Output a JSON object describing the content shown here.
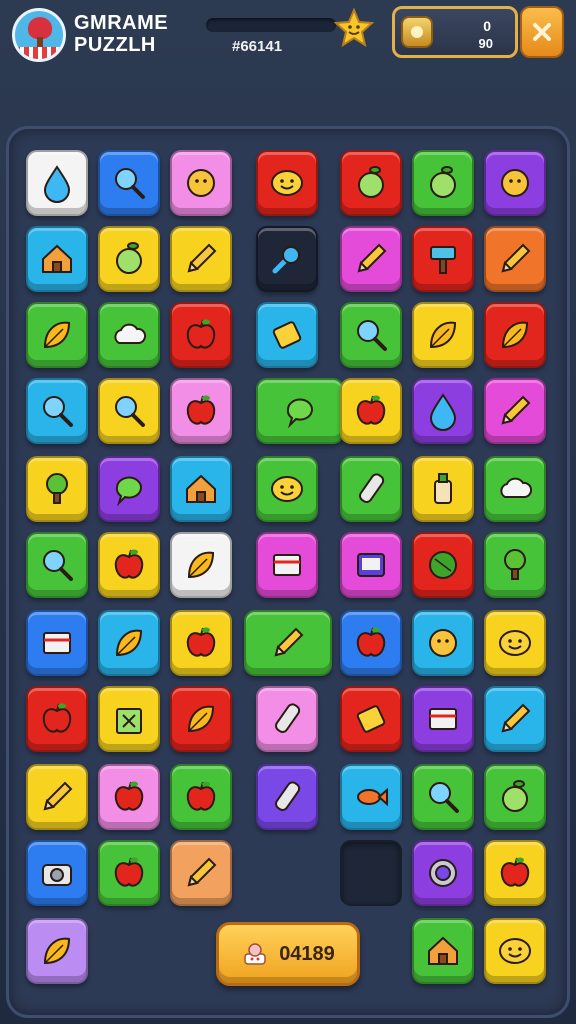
{
  "header": {
    "title_line1": "GMRAME",
    "title_line2": "PUZZLH",
    "progress_text": "#66141",
    "progress_fraction": 0.0,
    "coins_top": "0",
    "coins_bottom": "90"
  },
  "score_button": {
    "label": "04189"
  },
  "colors": {
    "white": "#f4f4f4",
    "blue": "#2e7df0",
    "pink": "#f28ee6",
    "red": "#e3261d",
    "green": "#47c33a",
    "purple": "#8d3ee0",
    "cyan": "#29b4ea",
    "yellow": "#f7d21f",
    "orange": "#f0742a",
    "dark": "#1e2638",
    "peach": "#f3a15e",
    "lavender": "#bb8cf2",
    "violet": "#7b48e8",
    "magenta": "#e34bd8"
  },
  "board": {
    "tiles": [
      {
        "item": "drop",
        "color": "white"
      },
      {
        "item": "search",
        "color": "blue"
      },
      {
        "item": "flower",
        "color": "pink"
      },
      {
        "item": "smile",
        "color": "red"
      },
      {
        "item": "fruit",
        "color": "red"
      },
      {
        "item": "fruit",
        "color": "green"
      },
      {
        "item": "flower",
        "color": "purple"
      },
      {
        "item": "house",
        "color": "cyan"
      },
      {
        "item": "fruit",
        "color": "yellow"
      },
      {
        "item": "pencil",
        "color": "yellow"
      },
      {
        "item": "brush",
        "color": "dark"
      },
      {
        "item": "pencil",
        "color": "magenta"
      },
      {
        "item": "hammer",
        "color": "red"
      },
      {
        "item": "pencil",
        "color": "orange"
      },
      {
        "item": "leaf",
        "color": "green"
      },
      {
        "item": "cloud",
        "color": "green"
      },
      {
        "item": "apple",
        "color": "red"
      },
      {
        "item": "tag",
        "color": "cyan"
      },
      {
        "item": "search",
        "color": "green"
      },
      {
        "item": "leaf",
        "color": "yellow"
      },
      {
        "item": "leaf",
        "color": "red"
      },
      {
        "item": "search",
        "color": "cyan"
      },
      {
        "item": "search",
        "color": "yellow"
      },
      {
        "item": "apple",
        "color": "pink"
      },
      {
        "item": "bubble",
        "color": "green"
      },
      {
        "item": "apple",
        "color": "yellow"
      },
      {
        "item": "drop",
        "color": "purple"
      },
      {
        "item": "pencil",
        "color": "magenta"
      },
      {
        "item": "tree",
        "color": "yellow"
      },
      {
        "item": "bubble",
        "color": "purple"
      },
      {
        "item": "house",
        "color": "cyan"
      },
      {
        "item": "smile",
        "color": "green"
      },
      {
        "item": "tube",
        "color": "green"
      },
      {
        "item": "bottle",
        "color": "yellow"
      },
      {
        "item": "cloud",
        "color": "green"
      },
      {
        "item": "search",
        "color": "green"
      },
      {
        "item": "apple",
        "color": "yellow"
      },
      {
        "item": "leaf",
        "color": "white"
      },
      {
        "item": "book",
        "color": "magenta"
      },
      {
        "item": "screen",
        "color": "magenta"
      },
      {
        "item": "ball",
        "color": "red"
      },
      {
        "item": "tree",
        "color": "green"
      },
      {
        "item": "book",
        "color": "blue"
      },
      {
        "item": "leaf",
        "color": "cyan"
      },
      {
        "item": "apple",
        "color": "yellow"
      },
      {
        "item": "pencil",
        "color": "green"
      },
      {
        "item": "apple",
        "color": "blue"
      },
      {
        "item": "flower",
        "color": "cyan"
      },
      {
        "item": "smile",
        "color": "yellow"
      },
      {
        "item": "apple",
        "color": "red"
      },
      {
        "item": "box",
        "color": "yellow"
      },
      {
        "item": "leaf",
        "color": "red"
      },
      {
        "item": "tube",
        "color": "pink"
      },
      {
        "item": "tag",
        "color": "red"
      },
      {
        "item": "book",
        "color": "purple"
      },
      {
        "item": "pencil",
        "color": "cyan"
      },
      {
        "item": "pencil",
        "color": "yellow"
      },
      {
        "item": "apple",
        "color": "pink"
      },
      {
        "item": "apple",
        "color": "green"
      },
      {
        "item": "tube",
        "color": "violet"
      },
      {
        "item": "fish",
        "color": "cyan"
      },
      {
        "item": "search",
        "color": "green"
      },
      {
        "item": "fruit",
        "color": "green"
      },
      {
        "item": "camera",
        "color": "blue"
      },
      {
        "item": "apple",
        "color": "green"
      },
      {
        "item": "pencil",
        "color": "peach"
      },
      {
        "item": "empty",
        "color": "dark"
      },
      {
        "item": "ring",
        "color": "purple"
      },
      {
        "item": "apple",
        "color": "yellow"
      },
      {
        "item": "leaf",
        "color": "lavender"
      },
      {
        "item": "house",
        "color": "green"
      },
      {
        "item": "smile",
        "color": "yellow"
      }
    ]
  }
}
